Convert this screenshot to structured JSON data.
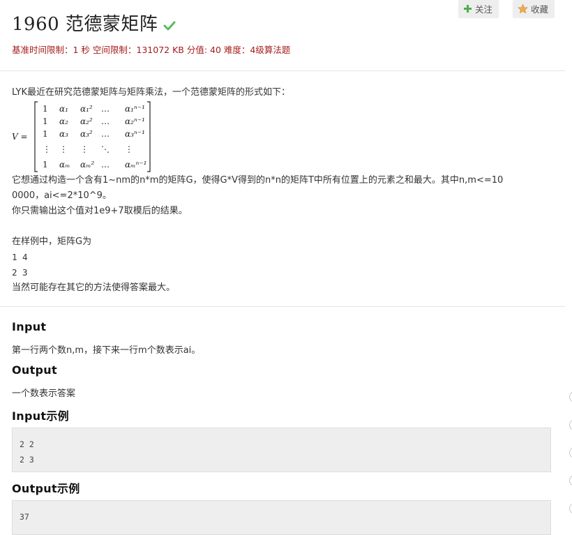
{
  "problem": {
    "title": "1960 范德蒙矩阵",
    "meta": "基准时间限制：1 秒 空间限制：131072 KB 分值: 40 难度：4级算法题"
  },
  "buttons": {
    "follow": "关注",
    "favorite": "收藏"
  },
  "description": {
    "intro": "LYK最近在研究范德蒙矩阵与矩阵乘法，一个范德蒙矩阵的形式如下：",
    "matrix_label": "V =",
    "matrix_rows": [
      [
        "1",
        "α₁",
        "α₁²",
        "…",
        "α₁ⁿ⁻¹"
      ],
      [
        "1",
        "α₂",
        "α₂²",
        "…",
        "α₂ⁿ⁻¹"
      ],
      [
        "1",
        "α₃",
        "α₃²",
        "…",
        "α₃ⁿ⁻¹"
      ],
      [
        "⋮",
        "⋮",
        "⋮",
        "⋱",
        "⋮"
      ],
      [
        "1",
        "αₘ",
        "αₘ²",
        "…",
        "αₘⁿ⁻¹"
      ]
    ],
    "line1a": "它想通过构造一个含有1~nm的n*m的矩阵G，使得G*V得到的n*n的矩阵T中所有位置上的元素之和最大。其中n,m<=10",
    "line1b": "0000，ai<=2*10^9。",
    "line2": "你只需输出这个值对1e9+7取模后的结果。",
    "line3": "在样例中，矩阵G为",
    "line4": "1 4",
    "line5": "2 3",
    "line6": "当然可能存在其它的方法使得答案最大。"
  },
  "sections": {
    "input_h": "Input",
    "input_t": "第一行两个数n,m，接下来一行m个数表示ai。",
    "output_h": "Output",
    "output_t": "一个数表示答案",
    "input_example_h": "Input示例",
    "input_example_lines": [
      "2 2",
      "2 3"
    ],
    "output_example_h": "Output示例",
    "output_example_lines": [
      "37"
    ]
  },
  "colors": {
    "meta_red": "#a61c1c",
    "check_green": "#5cb85c",
    "plus_green": "#4cae4c",
    "star_orange": "#f0ad4e"
  }
}
